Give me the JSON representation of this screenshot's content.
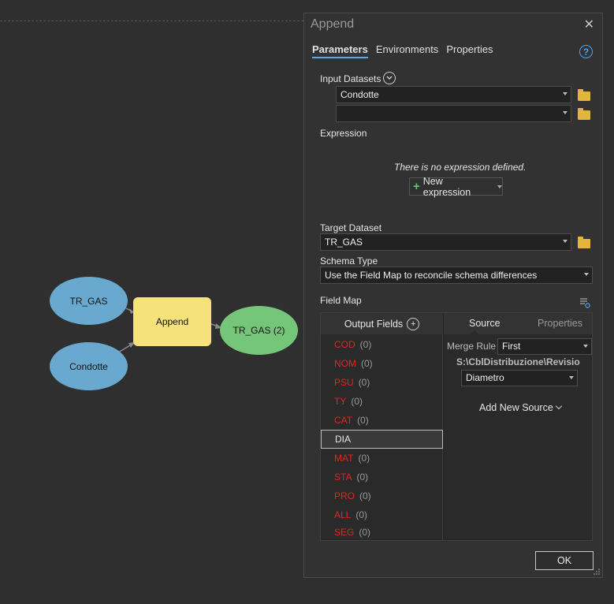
{
  "model": {
    "nodes": [
      {
        "label": "TR_GAS"
      },
      {
        "label": "Condotte"
      },
      {
        "label": "Append"
      },
      {
        "label": "TR_GAS (2)"
      }
    ],
    "colors": {
      "input": "#6aa9cf",
      "tool": "#f5e27a",
      "output": "#76c67a"
    }
  },
  "pane": {
    "title": "Append",
    "tabs": [
      "Parameters",
      "Environments",
      "Properties"
    ],
    "active_tab": "Parameters",
    "help_icon": "help-icon",
    "input_datasets": {
      "label": "Input Datasets",
      "items": [
        "Condotte",
        ""
      ]
    },
    "expression": {
      "label": "Expression",
      "empty_text": "There is no expression defined.",
      "new_button": "New expression"
    },
    "target_dataset": {
      "label": "Target Dataset",
      "value": "TR_GAS"
    },
    "schema_type": {
      "label": "Schema Type",
      "value": "Use the Field Map to reconcile schema differences"
    },
    "field_map": {
      "label": "Field Map",
      "output_fields_header": "Output Fields",
      "fields": [
        {
          "name": "COD",
          "count": "(0)"
        },
        {
          "name": "NOM",
          "count": "(0)"
        },
        {
          "name": "PSU",
          "count": "(0)"
        },
        {
          "name": "TY",
          "count": "(0)"
        },
        {
          "name": "CAT",
          "count": "(0)"
        },
        {
          "name": "DIA",
          "count": ""
        },
        {
          "name": "MAT",
          "count": "(0)"
        },
        {
          "name": "STA",
          "count": "(0)"
        },
        {
          "name": "PRO",
          "count": "(0)"
        },
        {
          "name": "ALL",
          "count": "(0)"
        },
        {
          "name": "SEG",
          "count": "(0)"
        }
      ],
      "selected_field": "DIA",
      "right_tabs": [
        "Source",
        "Properties"
      ],
      "merge_rule_label": "Merge Rule",
      "merge_rule_value": "First",
      "source_path": "S:\\CblDistribuzione\\Revisio",
      "source_field": "Diametro",
      "add_new_source": "Add New Source"
    },
    "ok_label": "OK"
  }
}
